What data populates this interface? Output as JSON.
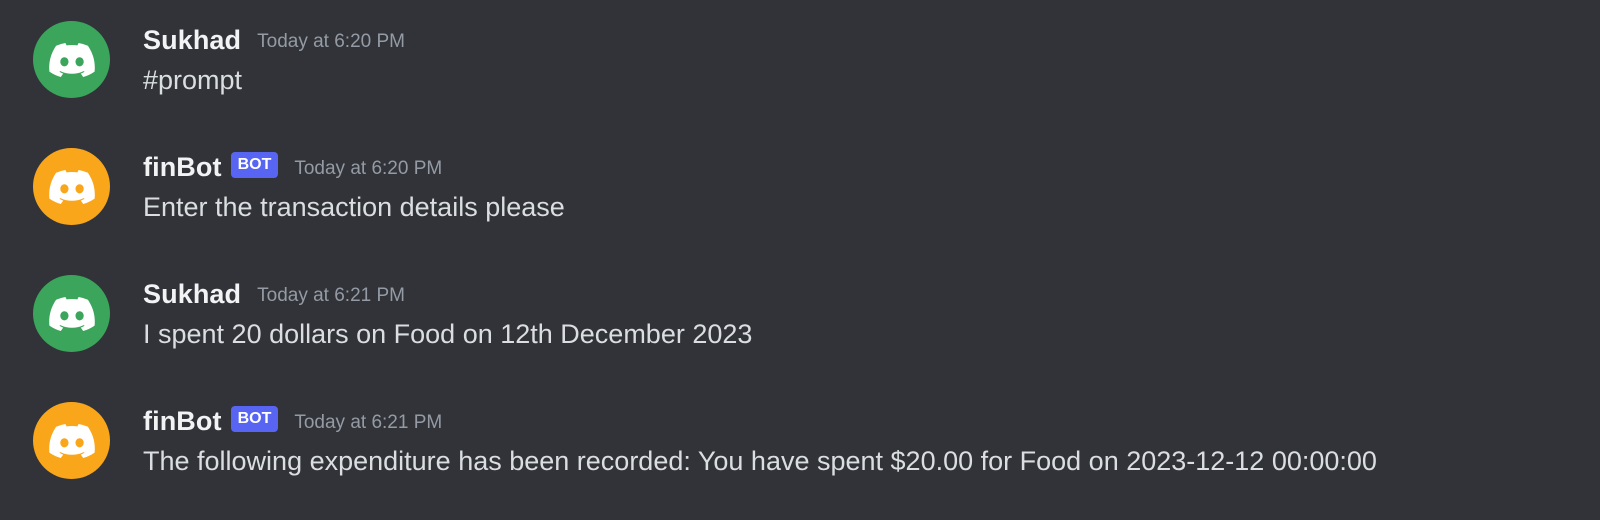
{
  "colors": {
    "background": "#313338",
    "avatar_green": "#3ba55c",
    "avatar_orange": "#faa61a",
    "bot_tag": "#5865f2"
  },
  "messages": [
    {
      "author": "Sukhad",
      "is_bot": false,
      "avatar_icon": "discord-logo-icon",
      "avatar_color": "#3ba55c",
      "timestamp": "Today at 6:20 PM",
      "content": "#prompt"
    },
    {
      "author": "finBot",
      "is_bot": true,
      "bot_label": "BOT",
      "avatar_icon": "discord-logo-icon",
      "avatar_color": "#faa61a",
      "timestamp": "Today at 6:20 PM",
      "content": "Enter the transaction details please"
    },
    {
      "author": "Sukhad",
      "is_bot": false,
      "avatar_icon": "discord-logo-icon",
      "avatar_color": "#3ba55c",
      "timestamp": "Today at 6:21 PM",
      "content": "I spent 20 dollars on Food on 12th December 2023"
    },
    {
      "author": "finBot",
      "is_bot": true,
      "bot_label": "BOT",
      "avatar_icon": "discord-logo-icon",
      "avatar_color": "#faa61a",
      "timestamp": "Today at 6:21 PM",
      "content": "The following expenditure has been recorded: You have spent $20.00 for Food on 2023-12-12 00:00:00"
    }
  ]
}
